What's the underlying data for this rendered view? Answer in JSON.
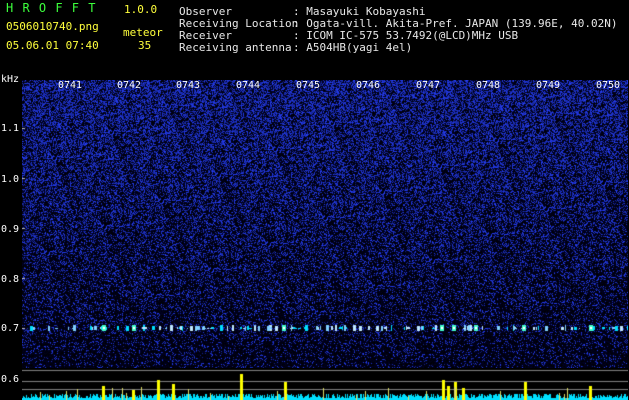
{
  "app": {
    "name_letters": "H R O F F T",
    "version": "1.0.0"
  },
  "file": {
    "name": "0506010740.png",
    "datetime": "05.06.01 07:40"
  },
  "meteor": {
    "label": "meteor",
    "count": "35"
  },
  "info": {
    "observer_label": "Observer",
    "observer_value": ": Masayuki Kobayashi",
    "location_label": "Receiving Location",
    "location_value": ": Ogata-vill. Akita-Pref. JAPAN (139.96E, 40.02N)",
    "receiver_label": "Receiver",
    "receiver_value": ": ICOM IC-575 53.7492(@LCD)MHz USB",
    "antenna_label": "Receiving antenna",
    "antenna_value": ": A504HB(yagi 4el)"
  },
  "axis": {
    "unit": "kHz",
    "y_ticks": [
      "1.1",
      "1.0",
      "0.9",
      "0.8",
      "0.7",
      "0.6"
    ],
    "time_ticks": [
      "0741",
      "0742",
      "0743",
      "0744",
      "0745",
      "0746",
      "0747",
      "0748",
      "0749",
      "0750"
    ]
  },
  "colors": {
    "background": "#000000",
    "noise_blue": "#2a3cff",
    "header_green": "#3cff3c",
    "header_yellow": "#ffff3c",
    "trace_cyan": "#00e0ff",
    "trace_yellow": "#ffff00"
  }
}
